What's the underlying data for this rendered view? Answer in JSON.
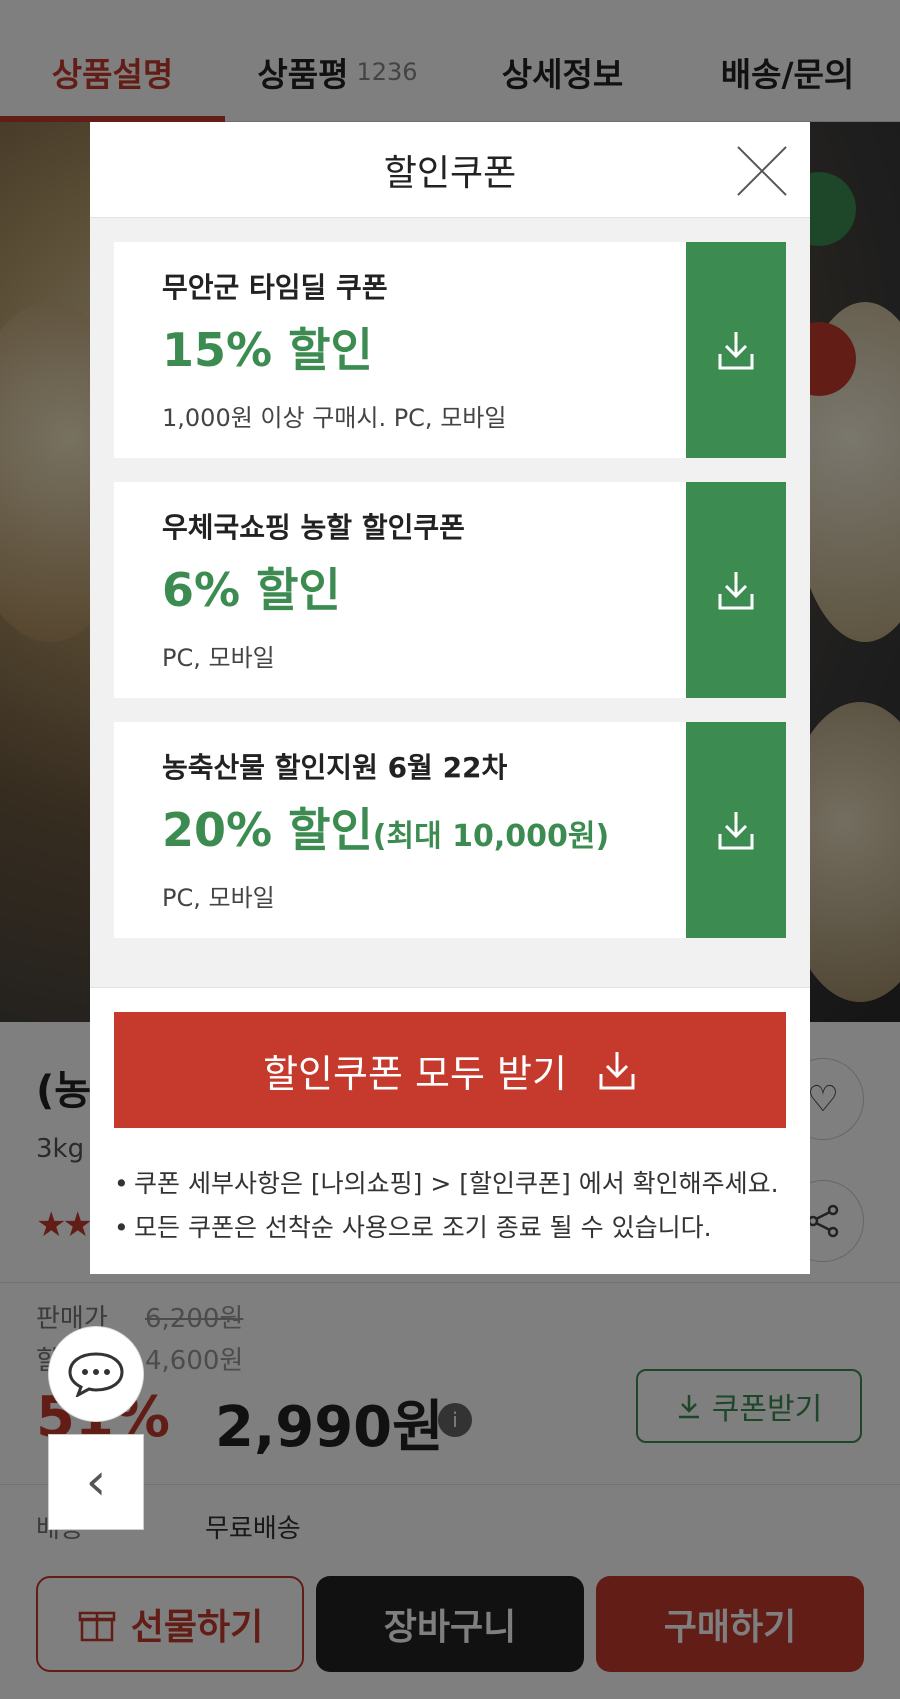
{
  "tabs": [
    {
      "label": "상품설명",
      "count": ""
    },
    {
      "label": "상품평",
      "count": "1236"
    },
    {
      "label": "상세정보",
      "count": ""
    },
    {
      "label": "배송/문의",
      "count": ""
    }
  ],
  "product": {
    "title": "(농",
    "weight": "3kg",
    "stars": "★★",
    "price_label": "판매가",
    "original_price": "6,200원",
    "sale_label": "할",
    "sale_price": "4,600원",
    "discount": "51%",
    "final_price": "2,990원",
    "coupon_button": "쿠폰받기",
    "shipping_label": "배송",
    "shipping_value": "무료배송"
  },
  "bottom_bar": {
    "gift": "선물하기",
    "cart": "장바구니",
    "buy": "구매하기"
  },
  "modal": {
    "title": "할인쿠폰",
    "coupons": [
      {
        "name": "무안군 타임딜 쿠폰",
        "rate": "15% 할인",
        "max": "",
        "condition": "1,000원 이상 구매시. PC, 모바일"
      },
      {
        "name": "우체국쇼핑 농할 할인쿠폰",
        "rate": "6% 할인",
        "max": "",
        "condition": "PC, 모바일"
      },
      {
        "name": "농축산물 할인지원 6월 22차",
        "rate": "20% 할인",
        "max": "(최대 10,000원)",
        "condition": "PC, 모바일"
      }
    ],
    "download_all": "할인쿠폰 모두 받기",
    "notes": [
      "쿠폰 세부사항은 [나의쇼핑] > [할인쿠폰] 에서 확인해주세요.",
      "모든 쿠폰은 선착순 사용으로 조기 종료 될 수 있습니다."
    ]
  },
  "colors": {
    "brand_red": "#c53a2d",
    "coupon_green": "#3c8c52"
  },
  "icons": [
    "close-icon",
    "download-icon",
    "heart-icon",
    "share-icon",
    "gift-icon",
    "chat-icon",
    "chevron-left-icon",
    "info-icon"
  ]
}
